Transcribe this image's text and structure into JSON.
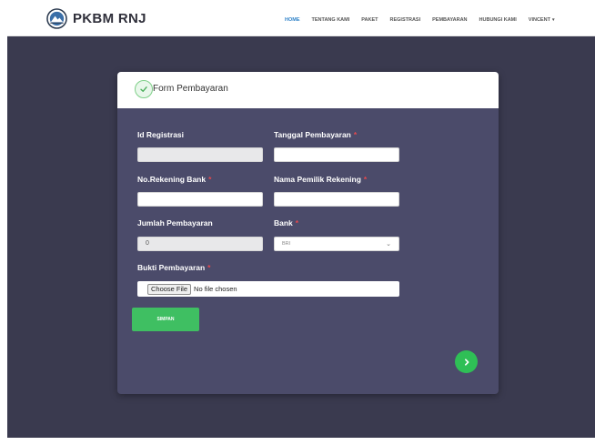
{
  "brand": {
    "name": "PKBM RNJ",
    "logo_icon": "mountain-logo-icon"
  },
  "nav": {
    "items": [
      {
        "label": "HOME",
        "active": true
      },
      {
        "label": "TENTANG KAMI",
        "active": false
      },
      {
        "label": "PAKET",
        "active": false
      },
      {
        "label": "REGISTRASI",
        "active": false
      },
      {
        "label": "PEMBAYARAN",
        "active": false
      },
      {
        "label": "HUBUNGI KAMI",
        "active": false
      }
    ],
    "user": "VINCENT",
    "user_caret": "▾"
  },
  "form": {
    "title": "Form Pembayaran",
    "fields": {
      "id_registrasi": {
        "label": "Id Registrasi",
        "value": "",
        "required": false
      },
      "tanggal_pembayaran": {
        "label": "Tanggal Pembayaran",
        "value": "",
        "required": true
      },
      "no_rekening": {
        "label": "No.Rekening Bank",
        "value": "",
        "required": true
      },
      "nama_pemilik": {
        "label": "Nama Pemilik Rekening",
        "value": "",
        "required": true
      },
      "jumlah_pembayaran": {
        "label": "Jumlah Pembayaran",
        "value": "0",
        "required": false
      },
      "bank": {
        "label": "Bank",
        "value": "BRI",
        "required": true
      },
      "bukti_pembayaran": {
        "label": "Bukti Pembayaran",
        "required": true,
        "button": "Choose File",
        "status": "No file chosen"
      }
    },
    "required_mark": "*",
    "submit_label": "SIMPAN",
    "next_icon": "chevron-right-icon"
  },
  "colors": {
    "page_bg": "#3a3a4f",
    "card_bg": "#4b4b6a",
    "accent": "#2f82c8",
    "success": "#3fbf62",
    "required": "#e5484d"
  }
}
